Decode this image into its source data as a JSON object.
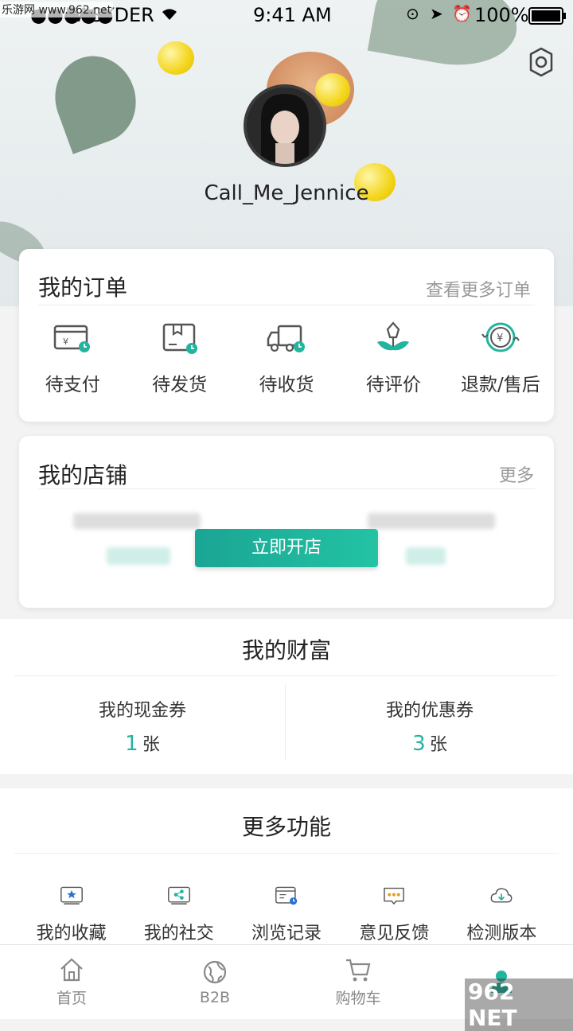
{
  "status_bar": {
    "carrier": "EASYDER",
    "time": "9:41 AM",
    "battery": "100%",
    "watermark": "乐游网 www.962.net"
  },
  "profile": {
    "username": "Call_Me_Jennice",
    "settings_icon": "gear-icon"
  },
  "orders": {
    "title": "我的订单",
    "more": "查看更多订单",
    "items": [
      {
        "label": "待支付",
        "icon": "wallet-clock-icon"
      },
      {
        "label": "待发货",
        "icon": "box-clock-icon"
      },
      {
        "label": "待收货",
        "icon": "truck-clock-icon"
      },
      {
        "label": "待评价",
        "icon": "flower-icon"
      },
      {
        "label": "退款/售后",
        "icon": "refund-icon"
      }
    ]
  },
  "shop": {
    "title": "我的店铺",
    "more": "更多",
    "open_button": "立即开店"
  },
  "wealth": {
    "title": "我的财富",
    "cash": {
      "label": "我的现金券",
      "count": "1",
      "unit": "张"
    },
    "coupon": {
      "label": "我的优惠券",
      "count": "3",
      "unit": "张"
    }
  },
  "more_functions": {
    "title": "更多功能",
    "items": [
      {
        "label": "我的收藏",
        "icon": "star-card-icon"
      },
      {
        "label": "我的社交",
        "icon": "share-icon"
      },
      {
        "label": "浏览记录",
        "icon": "history-icon"
      },
      {
        "label": "意见反馈",
        "icon": "chat-dots-icon"
      },
      {
        "label": "检测版本",
        "icon": "cloud-download-icon"
      }
    ]
  },
  "tabbar": {
    "items": [
      {
        "label": "首页",
        "icon": "home-icon"
      },
      {
        "label": "B2B",
        "icon": "globe-icon"
      },
      {
        "label": "购物车",
        "icon": "cart-icon"
      },
      {
        "label": "",
        "icon": "user-icon"
      }
    ]
  },
  "colors": {
    "accent": "#22b49e",
    "text": "#333333",
    "muted": "#999999"
  },
  "site_badge": "962 NET"
}
